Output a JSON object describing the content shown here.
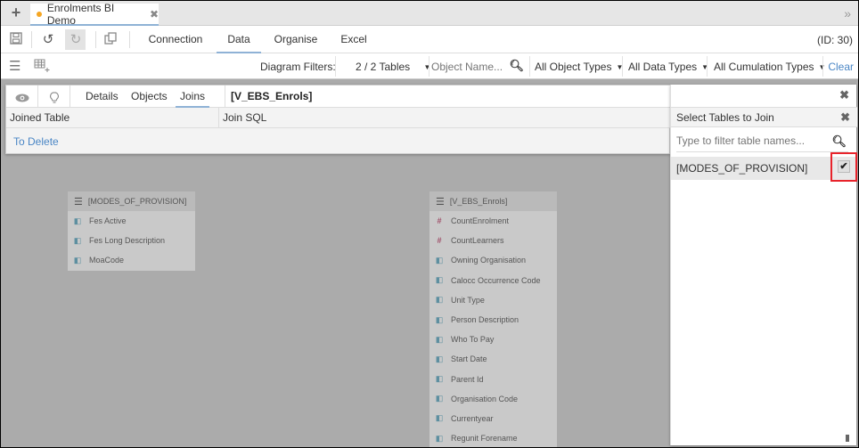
{
  "tabstrip": {
    "add_icon": "plus-icon",
    "doc_tab": {
      "title": "Enrolments BI Demo",
      "modified": true,
      "close_icon": "close-icon"
    },
    "overflow_icon": "double-chevron-right-icon"
  },
  "toolbar": {
    "icons": [
      "save-icon",
      "undo-icon",
      "redo-icon",
      "copy-icon"
    ],
    "menu": [
      {
        "label": "Connection",
        "active": false
      },
      {
        "label": "Data",
        "active": true
      },
      {
        "label": "Organise",
        "active": false
      },
      {
        "label": "Excel",
        "active": false
      }
    ],
    "id_label": "(ID: 30)"
  },
  "filterbar": {
    "icons": [
      "hamburger-icon",
      "add-table-icon"
    ],
    "label": "Diagram Filters:",
    "tables_select": "2 / 2 Tables",
    "object_search_placeholder": "Object Name...",
    "object_types": "All Object Types",
    "data_types": "All Data Types",
    "cumulation_types": "All Cumulation Types",
    "clear": "Clear"
  },
  "panel": {
    "icons": [
      "eye-icon",
      "lightbulb-icon"
    ],
    "tabs": [
      {
        "label": "Details",
        "active": false
      },
      {
        "label": "Objects",
        "active": false
      },
      {
        "label": "Joins",
        "active": true
      }
    ],
    "title": "[V_EBS_Enrols]",
    "columns": [
      "Joined Table",
      "Join SQL"
    ],
    "rows": [
      {
        "joined_table": "To Delete",
        "join_sql": ""
      }
    ]
  },
  "side_panel": {
    "title": "Select Tables to Join",
    "filter_placeholder": "Type to filter table names...",
    "tables": [
      {
        "name": "[MODES_OF_PROVISION]",
        "checked": true
      }
    ]
  },
  "diagram": {
    "tables": [
      {
        "name": "[MODES_OF_PROVISION]",
        "fields": [
          {
            "name": "Fes Active",
            "type": "dimension"
          },
          {
            "name": "Fes Long Description",
            "type": "dimension"
          },
          {
            "name": "MoaCode",
            "type": "dimension"
          }
        ]
      },
      {
        "name": "[V_EBS_Enrols]",
        "fields": [
          {
            "name": "CountEnrolment",
            "type": "measure"
          },
          {
            "name": "CountLearners",
            "type": "measure"
          },
          {
            "name": "Owning Organisation",
            "type": "dimension"
          },
          {
            "name": "Calocc Occurrence Code",
            "type": "dimension"
          },
          {
            "name": "Unit Type",
            "type": "dimension"
          },
          {
            "name": "Person Description",
            "type": "dimension"
          },
          {
            "name": "Who To Pay",
            "type": "dimension"
          },
          {
            "name": "Start Date",
            "type": "dimension"
          },
          {
            "name": "Parent Id",
            "type": "dimension"
          },
          {
            "name": "Organisation Code",
            "type": "dimension"
          },
          {
            "name": "Currentyear",
            "type": "dimension"
          },
          {
            "name": "Regunit Forename",
            "type": "dimension"
          }
        ]
      }
    ]
  }
}
